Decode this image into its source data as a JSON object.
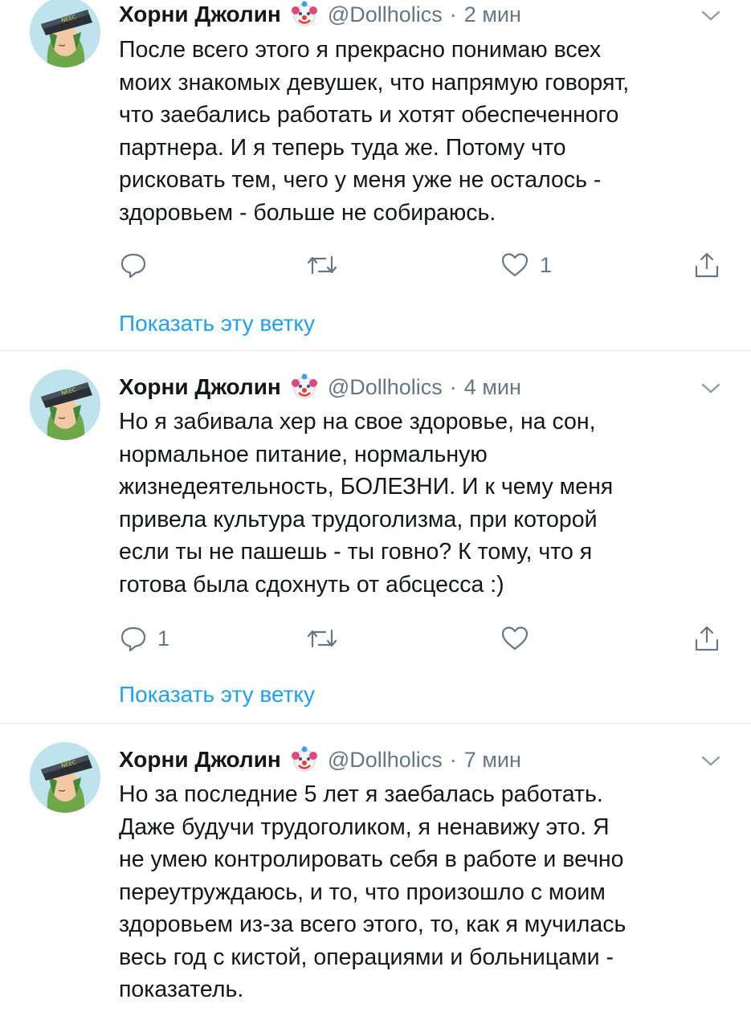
{
  "colors": {
    "accent": "#1da1f2",
    "secondary_text": "#657786",
    "separator": "#e6ecf0"
  },
  "tweets": [
    {
      "author_name": "Хорни Джолин",
      "author_emoji": "clown-face-icon",
      "handle": "@Dollholics",
      "separator": "·",
      "time": "2 мин",
      "text": "После всего этого я прекрасно понимаю всех\nмоих знакомых девушек, что напрямую говорят,\nчто заебались работать и хотят обеспеченного\nпартнера. И я теперь туда же. Потому что\nрисковать тем, чего у меня уже не осталось -\nздоровьем - больше не собираюсь.",
      "reply_count": "",
      "retweet_count": "",
      "like_count": "1",
      "show_thread": "Показать эту ветку"
    },
    {
      "author_name": "Хорни Джолин",
      "author_emoji": "clown-face-icon",
      "handle": "@Dollholics",
      "separator": "·",
      "time": "4 мин",
      "text": "Но я забивала хер на свое здоровье, на сон,\nнормальное питание,  нормальную\nжизнедеятельность,  БОЛЕЗНИ. И к чему меня\nпривела культура трудоголизма, при которой\nесли ты не пашешь - ты говно? К тому, что я\nготова была сдохнуть от абсцесса :)",
      "reply_count": "1",
      "retweet_count": "",
      "like_count": "",
      "show_thread": "Показать эту ветку"
    },
    {
      "author_name": "Хорни Джолин",
      "author_emoji": "clown-face-icon",
      "handle": "@Dollholics",
      "separator": "·",
      "time": "7 мин",
      "text": "Но за последние 5 лет я заебалась работать.\nДаже будучи трудоголиком, я ненавижу это. Я\nне умею контролировать себя в работе и вечно\nпереутруждаюсь, и то, что произошло с моим\nздоровьем из-за всего этого, то, как я мучилась\nвесь год с кистой, операциями и больницами -\nпоказатель."
    }
  ]
}
